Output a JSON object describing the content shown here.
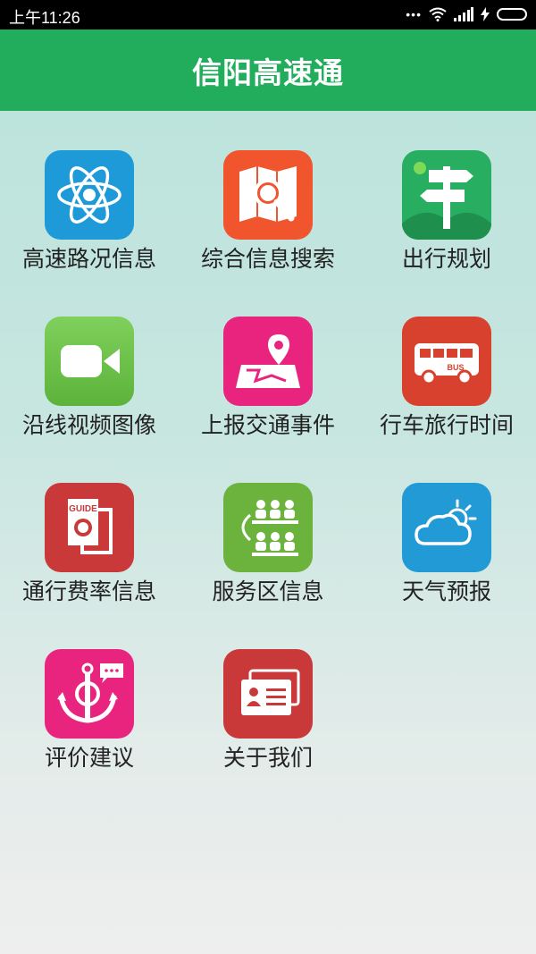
{
  "status": {
    "time": "上午11:26",
    "dots": "•••"
  },
  "header": {
    "title": "信阳高速通"
  },
  "menu": [
    {
      "label": "高速路况信息",
      "icon": "atom-icon",
      "color": "#1e9ad9"
    },
    {
      "label": "综合信息搜索",
      "icon": "map-search-icon",
      "color": "#f0552e"
    },
    {
      "label": "出行规划",
      "icon": "signpost-icon",
      "color": "#27ae60"
    },
    {
      "label": "沿线视频图像",
      "icon": "video-camera-icon",
      "color": "#6cc04a"
    },
    {
      "label": "上报交通事件",
      "icon": "map-pin-report-icon",
      "color": "#e8247f"
    },
    {
      "label": "行车旅行时间",
      "icon": "bus-icon",
      "color": "#d9412f"
    },
    {
      "label": "通行费率信息",
      "icon": "guide-book-icon",
      "color": "#c9393a"
    },
    {
      "label": "服务区信息",
      "icon": "service-area-people-icon",
      "color": "#6cb33e"
    },
    {
      "label": "天气预报",
      "icon": "weather-cloud-sun-icon",
      "color": "#229ad6"
    },
    {
      "label": "评价建议",
      "icon": "anchor-chat-icon",
      "color": "#e8247f"
    },
    {
      "label": "关于我们",
      "icon": "id-card-icon",
      "color": "#c9393a"
    }
  ],
  "bus_text": "BUS",
  "guide_text": "GUIDE"
}
